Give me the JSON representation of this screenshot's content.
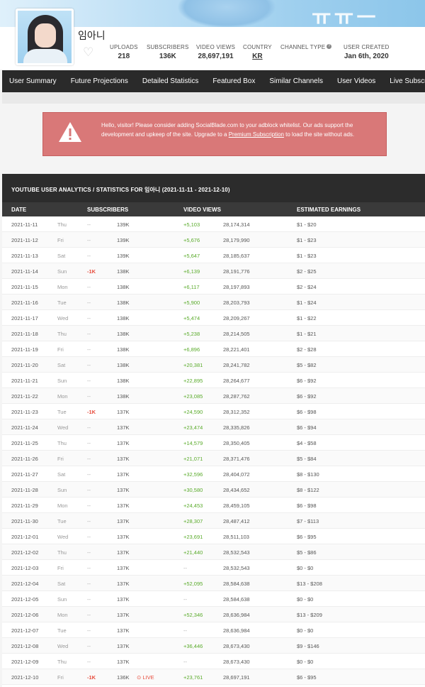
{
  "banner": {
    "deco_text": "ㅠㅠㅡ"
  },
  "channel": {
    "name": "임아니"
  },
  "stats": [
    {
      "label": "UPLOADS",
      "value": "218"
    },
    {
      "label": "SUBSCRIBERS",
      "value": "136K"
    },
    {
      "label": "VIDEO VIEWS",
      "value": "28,697,191"
    },
    {
      "label": "COUNTRY",
      "value": "KR"
    },
    {
      "label": "CHANNEL TYPE",
      "value": ""
    },
    {
      "label": "USER CREATED",
      "value": "Jan 6th, 2020"
    }
  ],
  "nav": [
    "User Summary",
    "Future Projections",
    "Detailed Statistics",
    "Featured Box",
    "Similar Channels",
    "User Videos",
    "Live Subscribe"
  ],
  "notice": {
    "text_before": "Hello, visitor! Please consider adding SocialBlade.com to your adblock whitelist. Our ads support the development and upkeep of the site. Upgrade to a ",
    "link": "Premium Subscription",
    "text_after": " to load the site without ads."
  },
  "table": {
    "title": "YOUTUBE USER ANALYTICS / STATISTICS FOR 임아니 (2021-11-11 - 2021-12-10)",
    "headers": {
      "date": "DATE",
      "subscribers": "SUBSCRIBERS",
      "views": "VIDEO VIEWS",
      "earnings": "ESTIMATED EARNINGS"
    },
    "rows": [
      {
        "date": "2021-11-11",
        "day": "Thu",
        "sub_delta": "--",
        "subs": "139K",
        "view_delta": "+5,103",
        "views": "28,174,314",
        "earnings": "$1  -  $20"
      },
      {
        "date": "2021-11-12",
        "day": "Fri",
        "sub_delta": "--",
        "subs": "139K",
        "view_delta": "+5,676",
        "views": "28,179,990",
        "earnings": "$1  -  $23"
      },
      {
        "date": "2021-11-13",
        "day": "Sat",
        "sub_delta": "--",
        "subs": "139K",
        "view_delta": "+5,647",
        "views": "28,185,637",
        "earnings": "$1  -  $23"
      },
      {
        "date": "2021-11-14",
        "day": "Sun",
        "sub_delta": "-1K",
        "subs": "138K",
        "view_delta": "+6,139",
        "views": "28,191,776",
        "earnings": "$2  -  $25"
      },
      {
        "date": "2021-11-15",
        "day": "Mon",
        "sub_delta": "--",
        "subs": "138K",
        "view_delta": "+6,117",
        "views": "28,197,893",
        "earnings": "$2  -  $24"
      },
      {
        "date": "2021-11-16",
        "day": "Tue",
        "sub_delta": "--",
        "subs": "138K",
        "view_delta": "+5,900",
        "views": "28,203,793",
        "earnings": "$1  -  $24"
      },
      {
        "date": "2021-11-17",
        "day": "Wed",
        "sub_delta": "--",
        "subs": "138K",
        "view_delta": "+5,474",
        "views": "28,209,267",
        "earnings": "$1  -  $22"
      },
      {
        "date": "2021-11-18",
        "day": "Thu",
        "sub_delta": "--",
        "subs": "138K",
        "view_delta": "+5,238",
        "views": "28,214,505",
        "earnings": "$1  -  $21"
      },
      {
        "date": "2021-11-19",
        "day": "Fri",
        "sub_delta": "--",
        "subs": "138K",
        "view_delta": "+6,896",
        "views": "28,221,401",
        "earnings": "$2  -  $28"
      },
      {
        "date": "2021-11-20",
        "day": "Sat",
        "sub_delta": "--",
        "subs": "138K",
        "view_delta": "+20,381",
        "views": "28,241,782",
        "earnings": "$5  -  $82"
      },
      {
        "date": "2021-11-21",
        "day": "Sun",
        "sub_delta": "--",
        "subs": "138K",
        "view_delta": "+22,895",
        "views": "28,264,677",
        "earnings": "$6  -  $92"
      },
      {
        "date": "2021-11-22",
        "day": "Mon",
        "sub_delta": "--",
        "subs": "138K",
        "view_delta": "+23,085",
        "views": "28,287,762",
        "earnings": "$6  -  $92"
      },
      {
        "date": "2021-11-23",
        "day": "Tue",
        "sub_delta": "-1K",
        "subs": "137K",
        "view_delta": "+24,590",
        "views": "28,312,352",
        "earnings": "$6  -  $98"
      },
      {
        "date": "2021-11-24",
        "day": "Wed",
        "sub_delta": "--",
        "subs": "137K",
        "view_delta": "+23,474",
        "views": "28,335,826",
        "earnings": "$6  -  $94"
      },
      {
        "date": "2021-11-25",
        "day": "Thu",
        "sub_delta": "--",
        "subs": "137K",
        "view_delta": "+14,579",
        "views": "28,350,405",
        "earnings": "$4  -  $58"
      },
      {
        "date": "2021-11-26",
        "day": "Fri",
        "sub_delta": "--",
        "subs": "137K",
        "view_delta": "+21,071",
        "views": "28,371,476",
        "earnings": "$5  -  $84"
      },
      {
        "date": "2021-11-27",
        "day": "Sat",
        "sub_delta": "--",
        "subs": "137K",
        "view_delta": "+32,596",
        "views": "28,404,072",
        "earnings": "$8  -  $130"
      },
      {
        "date": "2021-11-28",
        "day": "Sun",
        "sub_delta": "--",
        "subs": "137K",
        "view_delta": "+30,580",
        "views": "28,434,652",
        "earnings": "$8  -  $122"
      },
      {
        "date": "2021-11-29",
        "day": "Mon",
        "sub_delta": "--",
        "subs": "137K",
        "view_delta": "+24,453",
        "views": "28,459,105",
        "earnings": "$6  -  $98"
      },
      {
        "date": "2021-11-30",
        "day": "Tue",
        "sub_delta": "--",
        "subs": "137K",
        "view_delta": "+28,307",
        "views": "28,487,412",
        "earnings": "$7  -  $113"
      },
      {
        "date": "2021-12-01",
        "day": "Wed",
        "sub_delta": "--",
        "subs": "137K",
        "view_delta": "+23,691",
        "views": "28,511,103",
        "earnings": "$6  -  $95"
      },
      {
        "date": "2021-12-02",
        "day": "Thu",
        "sub_delta": "--",
        "subs": "137K",
        "view_delta": "+21,440",
        "views": "28,532,543",
        "earnings": "$5  -  $86"
      },
      {
        "date": "2021-12-03",
        "day": "Fri",
        "sub_delta": "--",
        "subs": "137K",
        "view_delta": "--",
        "views": "28,532,543",
        "earnings": "$0  -  $0"
      },
      {
        "date": "2021-12-04",
        "day": "Sat",
        "sub_delta": "--",
        "subs": "137K",
        "view_delta": "+52,095",
        "views": "28,584,638",
        "earnings": "$13  -  $208"
      },
      {
        "date": "2021-12-05",
        "day": "Sun",
        "sub_delta": "--",
        "subs": "137K",
        "view_delta": "--",
        "views": "28,584,638",
        "earnings": "$0  -  $0"
      },
      {
        "date": "2021-12-06",
        "day": "Mon",
        "sub_delta": "--",
        "subs": "137K",
        "view_delta": "+52,346",
        "views": "28,636,984",
        "earnings": "$13  -  $209"
      },
      {
        "date": "2021-12-07",
        "day": "Tue",
        "sub_delta": "--",
        "subs": "137K",
        "view_delta": "--",
        "views": "28,636,984",
        "earnings": "$0  -  $0"
      },
      {
        "date": "2021-12-08",
        "day": "Wed",
        "sub_delta": "--",
        "subs": "137K",
        "view_delta": "+36,446",
        "views": "28,673,430",
        "earnings": "$9  -  $146"
      },
      {
        "date": "2021-12-09",
        "day": "Thu",
        "sub_delta": "--",
        "subs": "137K",
        "view_delta": "--",
        "views": "28,673,430",
        "earnings": "$0  -  $0"
      },
      {
        "date": "2021-12-10",
        "day": "Fri",
        "sub_delta": "-1K",
        "subs": "136K",
        "live": "LIVE",
        "view_delta": "+23,761",
        "views": "28,697,191",
        "earnings": "$6  -  $95"
      }
    ]
  },
  "colors": {
    "nav_bg": "#2a2a2a",
    "notice_bg": "#d97878",
    "positive": "#5aab2b",
    "negative": "#e74c3c"
  }
}
